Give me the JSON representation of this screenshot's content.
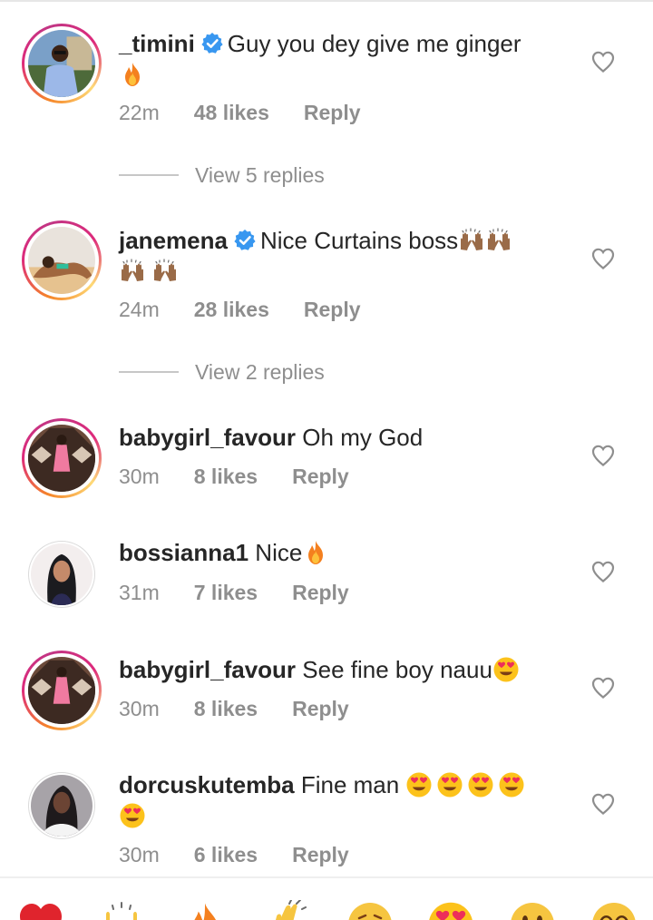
{
  "comments": [
    {
      "username": "_timini",
      "verified": true,
      "text": "Guy you dey give me ginger",
      "emoji_after": "fire",
      "time": "22m",
      "likes": "48 likes",
      "reply": "Reply",
      "view_replies": "View 5 replies"
    },
    {
      "username": "janemena",
      "verified": true,
      "text": "Nice Curtains boss",
      "emoji_after": "raised-hands x4",
      "time": "24m",
      "likes": "28 likes",
      "reply": "Reply",
      "view_replies": "View 2 replies"
    },
    {
      "username": "babygirl_favour",
      "verified": false,
      "text": "Oh my God",
      "time": "30m",
      "likes": "8 likes",
      "reply": "Reply"
    },
    {
      "username": "bossianna1",
      "verified": false,
      "text": "Nice",
      "emoji_after": "fire",
      "time": "31m",
      "likes": "7 likes",
      "reply": "Reply"
    },
    {
      "username": "babygirl_favour",
      "verified": false,
      "text": "See fine boy nauu",
      "emoji_after": "heart-eyes",
      "time": "30m",
      "likes": "8 likes",
      "reply": "Reply"
    },
    {
      "username": "dorcuskutemba",
      "verified": false,
      "text": "Fine man",
      "emoji_after": "heart-eyes x5",
      "time": "30m",
      "likes": "6 likes",
      "reply": "Reply"
    }
  ],
  "icons": {
    "like": "heart-outline-icon",
    "verified": "verified-badge-icon"
  },
  "reactions": [
    "red-heart",
    "raising-hands",
    "fire",
    "clapping-hands",
    "crying-face",
    "heart-eyes",
    "open-mouth-face",
    "laughing-face"
  ],
  "colors": {
    "text": "#262626",
    "meta": "#8e8e8e",
    "verified": "#3897f0",
    "story_ring_start": "#f58529",
    "story_ring_end": "#dd2a7b"
  }
}
